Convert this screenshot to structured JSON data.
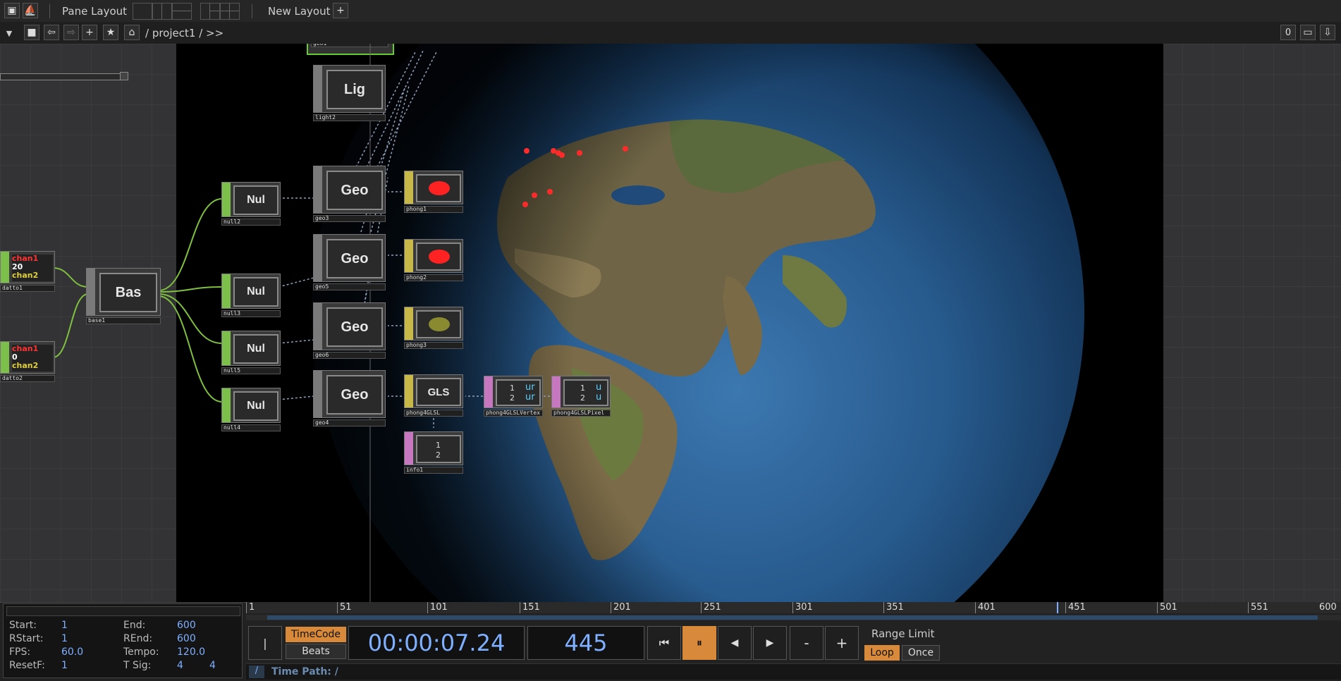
{
  "toolbar": {
    "pane_layout_label": "Pane Layout",
    "new_layout_label": "New Layout",
    "add_label": "+"
  },
  "nav": {
    "path": "/ project1 / >>",
    "right_value": "0"
  },
  "nodes": [
    {
      "id": "geo1",
      "label": "",
      "name": "geo1"
    },
    {
      "id": "light2",
      "label": "Lig",
      "name": "light2"
    },
    {
      "id": "geo3",
      "label": "Geo",
      "name": "geo3"
    },
    {
      "id": "geo5",
      "label": "Geo",
      "name": "geo5"
    },
    {
      "id": "geo6",
      "label": "Geo",
      "name": "geo6"
    },
    {
      "id": "geo4",
      "label": "Geo",
      "name": "geo4"
    },
    {
      "id": "null2",
      "label": "Nul",
      "name": "null2"
    },
    {
      "id": "null3",
      "label": "Nul",
      "name": "null3"
    },
    {
      "id": "null5",
      "label": "Nul",
      "name": "null5"
    },
    {
      "id": "null4",
      "label": "Nul",
      "name": "null4"
    },
    {
      "id": "base1",
      "label": "Bas",
      "name": "base1"
    },
    {
      "id": "datto1",
      "label": "",
      "name": "datto1"
    },
    {
      "id": "datto2",
      "label": "",
      "name": "datto2"
    },
    {
      "id": "phong1",
      "label": "",
      "name": "phong1"
    },
    {
      "id": "phong2",
      "label": "",
      "name": "phong2"
    },
    {
      "id": "phong3",
      "label": "",
      "name": "phong3"
    },
    {
      "id": "phong4glsl",
      "label": "GLS",
      "name": "phong4GLSL"
    },
    {
      "id": "phong4vertex",
      "label": "",
      "name": "phong4GLSLVertex"
    },
    {
      "id": "phong4pixel",
      "label": "",
      "name": "phong4GLSLPixel"
    },
    {
      "id": "info1",
      "label": "",
      "name": "info1"
    }
  ],
  "datto_text": {
    "line1": "chan1",
    "line2": "chan2",
    "v1": "20",
    "v2": "0"
  },
  "dat_text": {
    "row1": "1",
    "row2": "2",
    "u1": "ur",
    "u2": "ur",
    "u3": "u",
    "u4": "u"
  },
  "timeline": {
    "start_label": "Start:",
    "start": "1",
    "end_label": "End:",
    "end": "600",
    "rstart_label": "RStart:",
    "rstart": "1",
    "rend_label": "REnd:",
    "rend": "600",
    "fps_label": "FPS:",
    "fps": "60.0",
    "tempo_label": "Tempo:",
    "tempo": "120.0",
    "resetf_label": "ResetF:",
    "resetf": "1",
    "tsig_label": "T Sig:",
    "tsig_a": "4",
    "tsig_b": "4",
    "ticks": [
      "1",
      "51",
      "101",
      "151",
      "201",
      "251",
      "301",
      "351",
      "401",
      "451",
      "501",
      "551",
      "600"
    ],
    "current_frame_marker": "445",
    "timecode_label": "TimeCode",
    "beats_label": "Beats",
    "timecode": "00:00:07.24",
    "frame": "445",
    "range_limit_label": "Range Limit",
    "loop_label": "Loop",
    "once_label": "Once",
    "time_path_label": "Time Path: /",
    "slash_label": "/",
    "minus_label": "-",
    "plus_label": "+",
    "left_arrow_label": "|"
  },
  "colors": {
    "accent_orange": "#d88a3a",
    "blue_text": "#7fb0ff",
    "wire_green": "#7fc040",
    "top_green": "#66cc33",
    "comp_strip": "#7a7a7a",
    "mat_strip": "#c8b84a",
    "chop_strip": "#7cbf4a",
    "dat_strip": "#c777c0"
  }
}
